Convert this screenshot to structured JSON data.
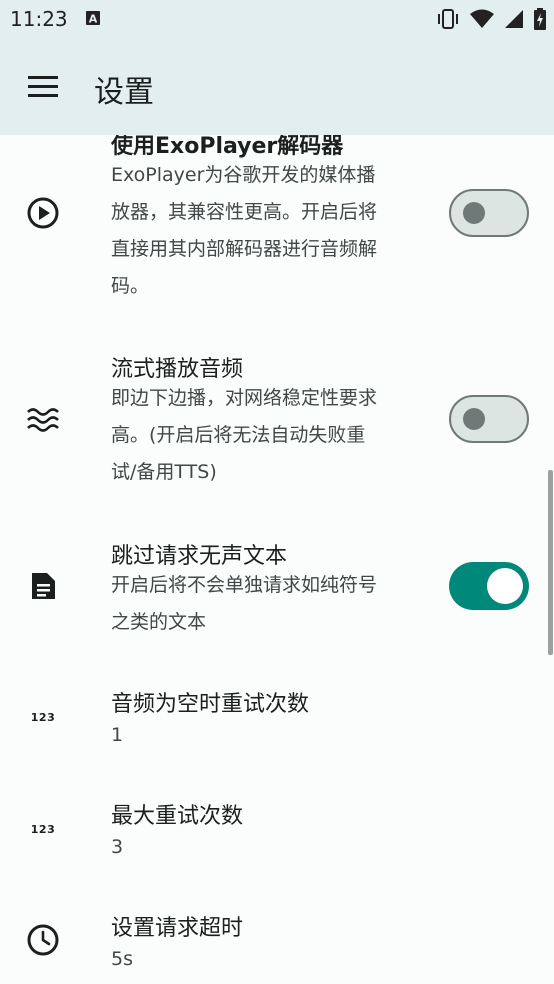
{
  "status_bar": {
    "time": "11:23",
    "notification_icon": "a-text-icon",
    "icons": [
      "vibrate-icon",
      "wifi-icon",
      "signal-icon",
      "battery-charging-icon"
    ]
  },
  "app_bar": {
    "menu_icon": "hamburger-menu-icon",
    "title": "设置"
  },
  "settings": {
    "items": [
      {
        "icon": "play-circle-icon",
        "title": "使用ExoPlayer解码器",
        "description_lines": [
          "ExoPlayer为谷歌开发的媒体播",
          "放器，其兼容性更高。开启后将",
          "直接用其内部解码器进行音频解",
          "码。"
        ],
        "switch_on": false
      },
      {
        "icon": "waves-icon",
        "title": "流式播放音频",
        "description_lines": [
          "即边下边播，对网络稳定性要求",
          "高。(开启后将无法自动失败重",
          "试/备用TTS)"
        ],
        "switch_on": false
      },
      {
        "icon": "document-icon",
        "title": "跳过请求无声文本",
        "description_lines": [
          "开启后将不会单独请求如纯符号",
          "之类的文本"
        ],
        "switch_on": true
      },
      {
        "icon": "numbers-icon",
        "icon_text": "123",
        "title": "音频为空时重试次数",
        "value": "1"
      },
      {
        "icon": "numbers-icon",
        "icon_text": "123",
        "title": "最大重试次数",
        "value": "3"
      },
      {
        "icon": "clock-icon",
        "title": "设置请求超时",
        "value": "5s"
      }
    ]
  },
  "colors": {
    "app_bar_bg": "#e3efee",
    "accent": "#00897b",
    "switch_off_track": "#dde5e3",
    "switch_off_outline": "#6f7977"
  }
}
